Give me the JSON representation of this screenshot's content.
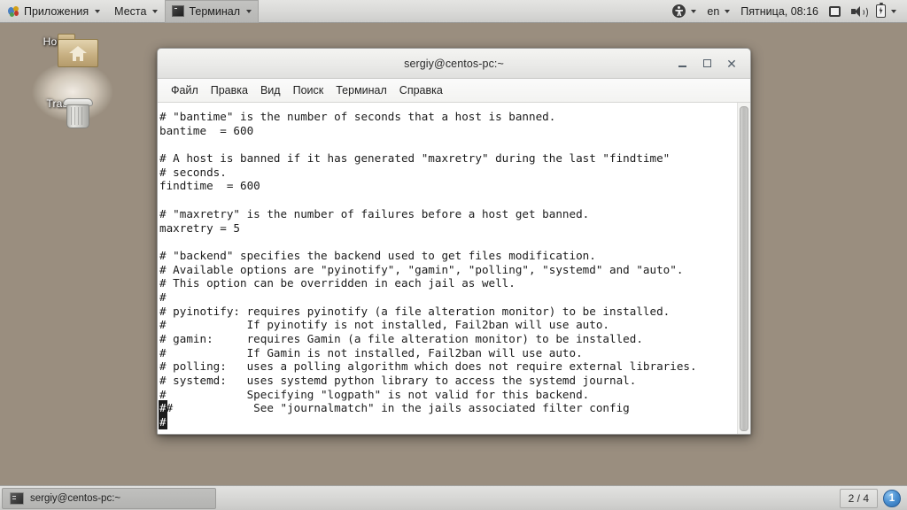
{
  "top_panel": {
    "menus": [
      {
        "label": "Приложения",
        "icon": "gnome-foot-icon",
        "has_caret": true,
        "active": false
      },
      {
        "label": "Места",
        "icon": null,
        "has_caret": true,
        "active": false
      },
      {
        "label": "Терминал",
        "icon": "terminal-icon",
        "has_caret": true,
        "active": true
      }
    ],
    "right": {
      "accessibility_icon": "universal-access-icon",
      "accessibility_caret": true,
      "keyboard_layout": "en",
      "keyboard_caret": true,
      "clock": "Пятница, 08:16",
      "display_icon": "display-icon",
      "volume_icon": "volume-icon",
      "battery_icon": "battery-icon",
      "battery_caret": true
    }
  },
  "desktop_icons": [
    {
      "name": "home-folder",
      "label": "Home",
      "icon": "folder-home-icon"
    },
    {
      "name": "trash",
      "label": "Trash",
      "icon": "trash-icon"
    }
  ],
  "terminal": {
    "title": "sergiy@centos-pc:~",
    "window_buttons": {
      "minimize": "_",
      "maximize": "□",
      "close": "×"
    },
    "menu_bar": [
      "Файл",
      "Правка",
      "Вид",
      "Поиск",
      "Терминал",
      "Справка"
    ],
    "lines": [
      "# \"bantime\" is the number of seconds that a host is banned.",
      "bantime  = 600",
      "",
      "# A host is banned if it has generated \"maxretry\" during the last \"findtime\"",
      "# seconds.",
      "findtime  = 600",
      "",
      "# \"maxretry\" is the number of failures before a host get banned.",
      "maxretry = 5",
      "",
      "# \"backend\" specifies the backend used to get files modification.",
      "# Available options are \"pyinotify\", \"gamin\", \"polling\", \"systemd\" and \"auto\".",
      "# This option can be overridden in each jail as well.",
      "#",
      "# pyinotify: requires pyinotify (a file alteration monitor) to be installed.",
      "#            If pyinotify is not installed, Fail2ban will use auto.",
      "# gamin:     requires Gamin (a file alteration monitor) to be installed.",
      "#            If Gamin is not installed, Fail2ban will use auto.",
      "# polling:   uses a polling algorithm which does not require external libraries.",
      "# systemd:   uses systemd python library to access the systemd journal.",
      "#            Specifying \"logpath\" is not valid for this backend.",
      "#            See \"journalmatch\" in the jails associated filter config"
    ],
    "cursor_char": "#",
    "cursor_line_index": 21
  },
  "bottom_panel": {
    "task_button_label": "sergiy@centos-pc:~",
    "task_button_icon": "terminal-icon",
    "workspace": "2 / 4",
    "notification_count": "1"
  },
  "colors": {
    "panel_bg": "#d9d9d7",
    "terminal_bg": "#ffffff",
    "terminal_fg": "#1b1b1b",
    "badge_blue": "#4e93d4"
  }
}
